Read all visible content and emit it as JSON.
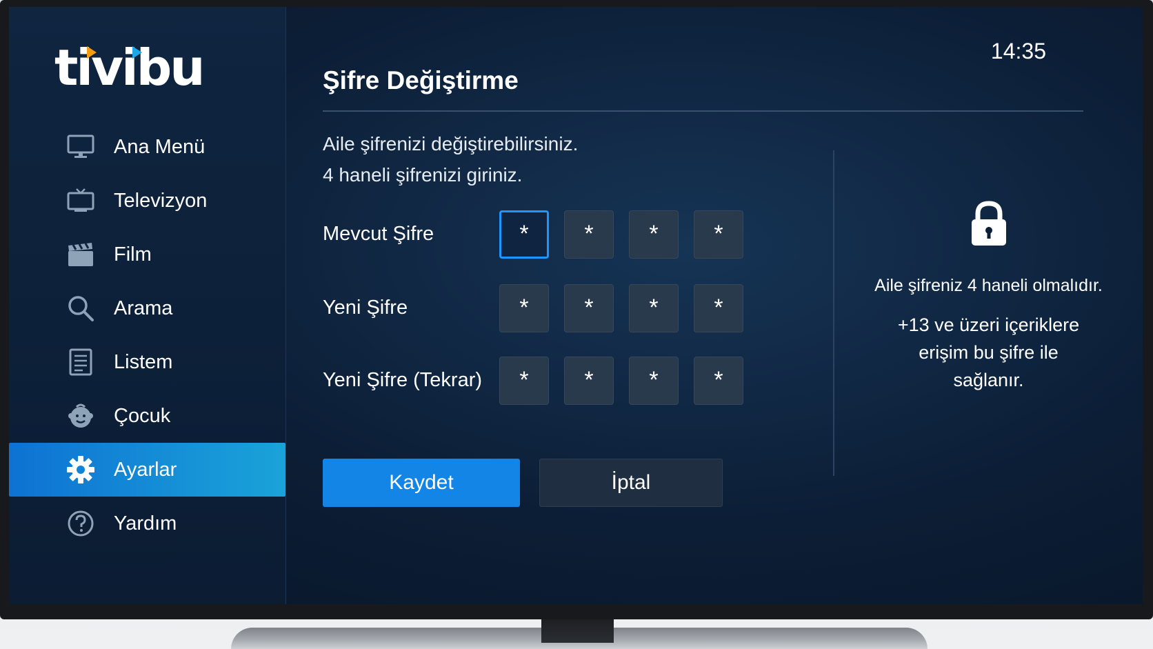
{
  "brand": {
    "logo_text": "tivibu"
  },
  "clock": "14:35",
  "sidebar": {
    "items": [
      {
        "label": "Ana Menü",
        "icon": "monitor-icon",
        "active": false
      },
      {
        "label": "Televizyon",
        "icon": "tv-icon",
        "active": false
      },
      {
        "label": "Film",
        "icon": "clapperboard-icon",
        "active": false
      },
      {
        "label": "Arama",
        "icon": "search-icon",
        "active": false
      },
      {
        "label": "Listem",
        "icon": "list-icon",
        "active": false
      },
      {
        "label": "Çocuk",
        "icon": "child-face-icon",
        "active": false
      },
      {
        "label": "Ayarlar",
        "icon": "gear-icon",
        "active": true
      },
      {
        "label": "Yardım",
        "icon": "help-icon",
        "active": false
      }
    ]
  },
  "main": {
    "title": "Şifre Değiştirme",
    "description_line1": "Aile şifrenizi değiştirebilirsiniz.",
    "description_line2": "4 haneli şifrenizi giriniz.",
    "fields": [
      {
        "label": "Mevcut Şifre",
        "digits": [
          "*",
          "*",
          "*",
          "*"
        ]
      },
      {
        "label": "Yeni Şifre",
        "digits": [
          "*",
          "*",
          "*",
          "*"
        ]
      },
      {
        "label": "Yeni Şifre (Tekrar)",
        "digits": [
          "*",
          "*",
          "*",
          "*"
        ]
      }
    ],
    "save_label": "Kaydet",
    "cancel_label": "İptal"
  },
  "info": {
    "line1": "Aile şifreniz 4 haneli olmalıdır.",
    "line2a": "+13 ve üzeri içeriklere",
    "line2b": "erişim bu şifre ile",
    "line2c": "sağlanır."
  },
  "colors": {
    "accent": "#1285e6",
    "active_nav_start": "#0e72d3",
    "active_nav_end": "#1aa3d9",
    "logo_orange": "#f39c12",
    "logo_blue": "#1ea7e8",
    "focus_border": "#1e96ff"
  }
}
